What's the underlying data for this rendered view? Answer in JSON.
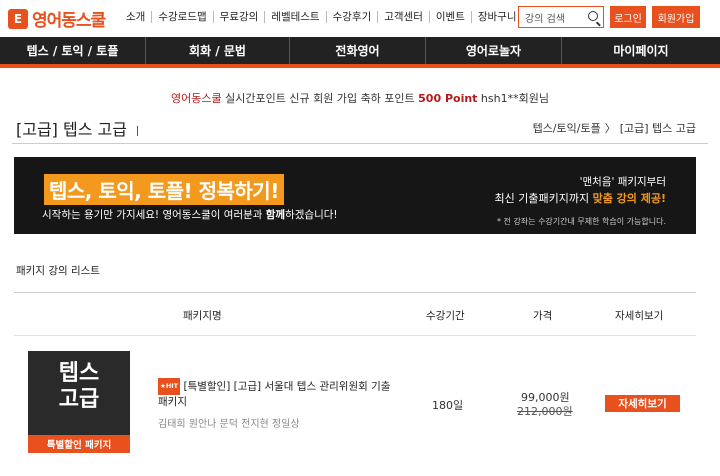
{
  "header": {
    "logo_mark": "E",
    "logo_text": "영어동스쿨",
    "nav": [
      "소개",
      "수강로드맵",
      "무료강의",
      "레벨테스트",
      "수강후기",
      "고객센터",
      "이벤트",
      "장바구니"
    ],
    "search_placeholder": "강의 검색",
    "login_label": "로그인",
    "join_label": "회원가입",
    "accent_color": "#e8501d"
  },
  "mainnav": [
    {
      "label": "텝스 / 토익 / 토플"
    },
    {
      "label": "회화 / 문법"
    },
    {
      "label": "전화영어"
    },
    {
      "label": "영어로놀자"
    },
    {
      "label": "마이페이지"
    }
  ],
  "notice": {
    "brand": "영어동스쿨",
    "mid": " 실시간포인트 신규 회원 가입 축하 포인트 ",
    "point": "500 Point",
    "user": " hsh1**회원님"
  },
  "page": {
    "title": "[고급] 텝스 고급",
    "breadcrumb": [
      "텝스/토익/토플",
      "〉",
      "[고급] 텝스 고급"
    ]
  },
  "banner": {
    "headline": "텝스, 토익, 토플! 정복하기!",
    "sub_a": "시작하는 용기만 가지세요! 영어동스쿨이 여러분과 ",
    "sub_bold": "함께",
    "sub_b": "하겠습니다!",
    "right_line1": "'맨처음' 패키지부터",
    "right_line2a": "최신 기출패키지까지 ",
    "right_line2_em": "맞춤 강의 제공!",
    "right_note": "* 전 강좌는 수강기간내 무제한 학습이 가능합니다."
  },
  "list": {
    "title": "패키지 강의 리스트",
    "columns": [
      "패키지명",
      "수강기간",
      "가격",
      "자세히보기"
    ],
    "items": [
      {
        "thumb_line1": "텝스",
        "thumb_line2": "고급",
        "thumb_tag": "특별할인 패키지",
        "badge": "★HIT",
        "name": "[특별할인] [고급] 서울대 텝스 관리위원회 기출 패키지",
        "teachers": "김태희 원안나 문덕 전지현 정일상",
        "duration": "180일",
        "price": "99,000원",
        "price_original": "212,000원",
        "detail_label": "자세히보기"
      }
    ]
  }
}
